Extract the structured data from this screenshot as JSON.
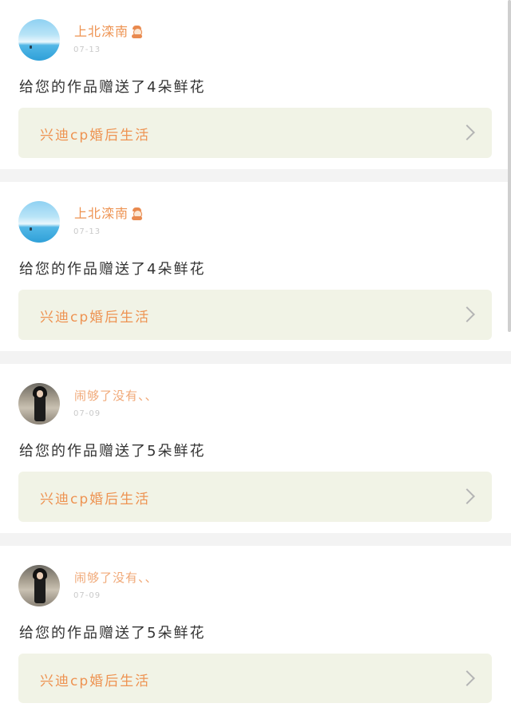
{
  "items": [
    {
      "username": "上北滦南",
      "avatar": "sky-sea-avatar",
      "date": "07-13",
      "message": "给您的作品赠送了4朵鲜花",
      "work_title": "兴迪cp婚后生活",
      "has_emoji": true
    },
    {
      "username": "上北滦南",
      "avatar": "sky-sea-avatar",
      "date": "07-13",
      "message": "给您的作品赠送了4朵鲜花",
      "work_title": "兴迪cp婚后生活",
      "has_emoji": true
    },
    {
      "username": "闹够了没有、、",
      "avatar": "person-photo-avatar",
      "date": "07-09",
      "message": "给您的作品赠送了5朵鲜花",
      "work_title": "兴迪cp婚后生活",
      "has_emoji": false
    },
    {
      "username": "闹够了没有、、",
      "avatar": "person-photo-avatar",
      "date": "07-09",
      "message": "给您的作品赠送了5朵鲜花",
      "work_title": "兴迪cp婚后生活",
      "has_emoji": false
    }
  ],
  "colors": {
    "accent": "#ee9352",
    "link_bg": "#f1f3e6",
    "text": "#333333",
    "date": "#c9c9c9",
    "page_bg": "#f3f3f3"
  },
  "icons": {
    "emoji": "snowman-emoji-icon",
    "chevron": "chevron-right-icon"
  }
}
